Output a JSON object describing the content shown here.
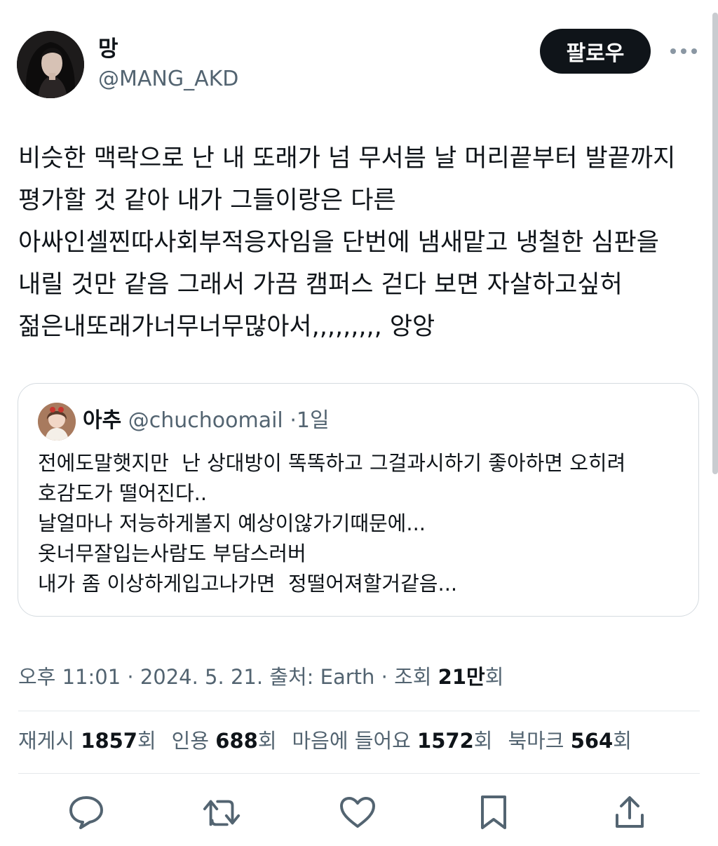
{
  "author": {
    "display_name": "망",
    "handle": "@MANG_AKD",
    "follow_label": "팔로우"
  },
  "tweet": {
    "text": "비슷한 맥락으로 난 내 또래가 넘 무서븜 날 머리끝부터 발끝까지 평가할 것 같아 내가 그들이랑은 다른 아싸인셀찐따사회부적응자임을 단번에 냄새맡고 냉철한 심판을 내릴 것만 같음 그래서 가끔 캠퍼스 걷다 보면 자살하고싶허 젊은내또래가너무너무많아서,,,,,,,,, 앙앙"
  },
  "quote": {
    "name": "아추",
    "handle": "@chuchoomail",
    "separator": "·",
    "time": "1일",
    "text": "전에도말햇지만  난 상대방이 똑똑하고 그걸과시하기 좋아하면 오히려 호감도가 떨어진다..\n날얼마나 저능하게볼지 예상이않가기때문에...\n옷너무잘입는사람도 부담스러버\n내가 좀 이상하게입고나가면  정떨어져할거같음..."
  },
  "meta": {
    "time": "오후 11:01",
    "date": "2024. 5. 21.",
    "source": "출처: Earth",
    "views_label": "조회",
    "views_count": "21만",
    "views_suffix": "회",
    "sep": "·"
  },
  "stats": {
    "reposts_label": "재게시",
    "reposts_count": "1857",
    "quotes_label": "인용",
    "quotes_count": "688",
    "likes_label": "마음에 들어요",
    "likes_count": "1572",
    "bookmarks_label": "북마크",
    "bookmarks_count": "564",
    "unit": "회"
  },
  "actions": {
    "icons": [
      "reply-icon",
      "repost-icon",
      "like-icon",
      "bookmark-icon",
      "share-icon"
    ]
  },
  "colors": {
    "text_primary": "#0f1419",
    "text_secondary": "#536471",
    "border": "#d5dbe0",
    "follow_bg": "#0f1419"
  }
}
